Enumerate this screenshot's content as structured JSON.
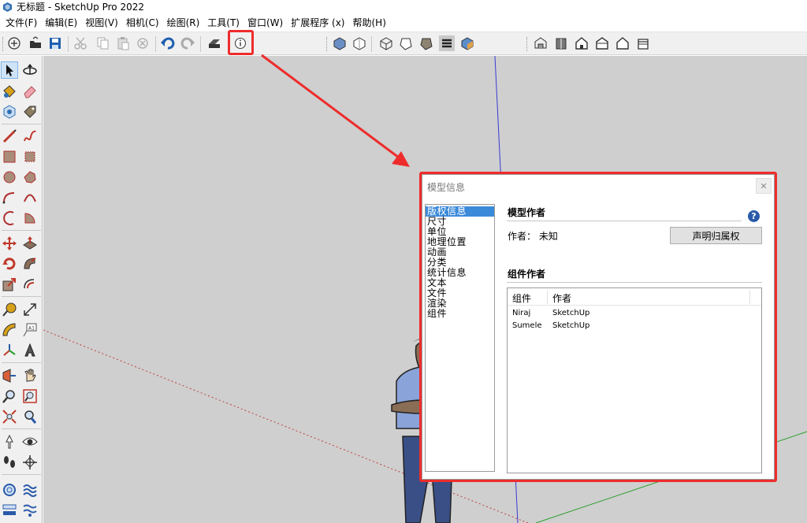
{
  "window": {
    "title": "无标题 - SketchUp Pro 2022"
  },
  "menu": [
    "文件(F)",
    "编辑(E)",
    "视图(V)",
    "相机(C)",
    "绘图(R)",
    "工具(T)",
    "窗口(W)",
    "扩展程序 (x)",
    "帮助(H)"
  ],
  "colors": {
    "highlight": "#ee2c2c",
    "selection": "#3b8ad9",
    "viewport": "#cfcfcf",
    "blue_axis": "#3a3ad6",
    "green_axis": "#2aa02a",
    "red_axis": "#c04040"
  },
  "dialog": {
    "title": "模型信息",
    "close_icon": "close-icon",
    "nav_items": [
      "版权信息",
      "尺寸",
      "单位",
      "地理位置",
      "动画",
      "分类",
      "统计信息",
      "文本",
      "文件",
      "渲染",
      "组件"
    ],
    "selected_index": 0,
    "model_author_heading": "模型作者",
    "author_label": "作者： 未知",
    "claim_button": "声明归属权",
    "component_authors_heading": "组件作者",
    "table": {
      "headers": [
        "组件",
        "作者"
      ],
      "rows": [
        {
          "component": "Niraj",
          "author": "SketchUp"
        },
        {
          "component": "Sumele",
          "author": "SketchUp"
        }
      ]
    }
  }
}
